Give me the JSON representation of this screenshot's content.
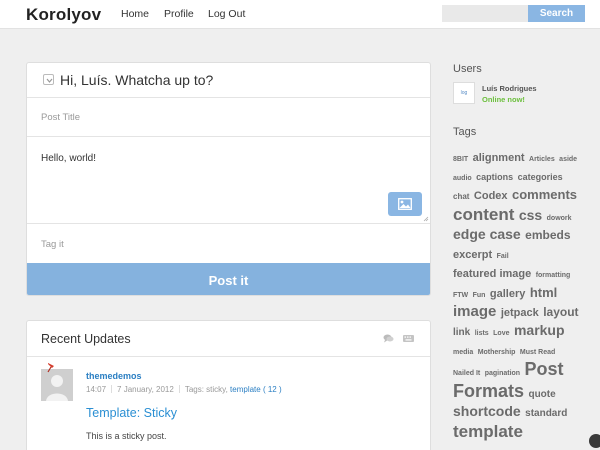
{
  "site": {
    "brand": "Korolyov"
  },
  "nav": [
    "Home",
    "Profile",
    "Log Out"
  ],
  "search": {
    "button": "Search",
    "placeholder": ""
  },
  "composer": {
    "greeting": "Hi, Luís. Whatcha up to?",
    "title_placeholder": "Post Title",
    "content": "Hello, world!",
    "tag_placeholder": "Tag it",
    "submit_label": "Post it",
    "icons": [
      "chevron-down-icon",
      "image-icon",
      "resize-handle-icon"
    ]
  },
  "recent": {
    "title": "Recent Updates",
    "icons": [
      "comments-icon",
      "keyboard-icon"
    ],
    "post": {
      "author": "themedemos",
      "time": "14:07",
      "date": "7 January, 2012",
      "tags_label": "Tags: sticky,",
      "tag_link": "template ( 12 )",
      "title": "Template: Sticky",
      "excerpt": "This is a sticky post."
    }
  },
  "sidebar": {
    "users_title": "Users",
    "user": {
      "avatar_text": "log",
      "name": "Luís Rodrigues",
      "status": "Online now!"
    },
    "tags_title": "Tags",
    "tags": [
      {
        "label": "8BIT",
        "size": 7
      },
      {
        "label": "alignment",
        "size": 11
      },
      {
        "label": "Articles",
        "size": 7
      },
      {
        "label": "aside",
        "size": 7
      },
      {
        "label": "audio",
        "size": 7
      },
      {
        "label": "captions",
        "size": 9
      },
      {
        "label": "categories",
        "size": 9
      },
      {
        "label": "chat",
        "size": 8
      },
      {
        "label": "Codex",
        "size": 11
      },
      {
        "label": "comments",
        "size": 13
      },
      {
        "label": "content",
        "size": 17
      },
      {
        "label": "css",
        "size": 14
      },
      {
        "label": "dowork",
        "size": 7
      },
      {
        "label": "edge case",
        "size": 14
      },
      {
        "label": "embeds",
        "size": 12
      },
      {
        "label": "excerpt",
        "size": 11
      },
      {
        "label": "Fail",
        "size": 7
      },
      {
        "label": "featured image",
        "size": 11
      },
      {
        "label": "formatting",
        "size": 7
      },
      {
        "label": "FTW",
        "size": 7
      },
      {
        "label": "Fun",
        "size": 7
      },
      {
        "label": "gallery",
        "size": 11
      },
      {
        "label": "html",
        "size": 13
      },
      {
        "label": "image",
        "size": 15
      },
      {
        "label": "jetpack",
        "size": 11
      },
      {
        "label": "layout",
        "size": 12
      },
      {
        "label": "link",
        "size": 10
      },
      {
        "label": "lists",
        "size": 7
      },
      {
        "label": "Love",
        "size": 7
      },
      {
        "label": "markup",
        "size": 14
      },
      {
        "label": "media",
        "size": 7
      },
      {
        "label": "Mothership",
        "size": 7
      },
      {
        "label": "Must Read",
        "size": 7
      },
      {
        "label": "Nailed It",
        "size": 7
      },
      {
        "label": "pagination",
        "size": 7
      },
      {
        "label": "Post",
        "size": 18
      },
      {
        "label": "Formats",
        "size": 18
      },
      {
        "label": "quote",
        "size": 10
      },
      {
        "label": "shortcode",
        "size": 14
      },
      {
        "label": "standard",
        "size": 10
      },
      {
        "label": "template",
        "size": 17
      }
    ]
  },
  "colors": {
    "accent": "#85b2de",
    "link": "#2b7fc3",
    "online": "#6cbf3d",
    "background": "#efefef"
  }
}
